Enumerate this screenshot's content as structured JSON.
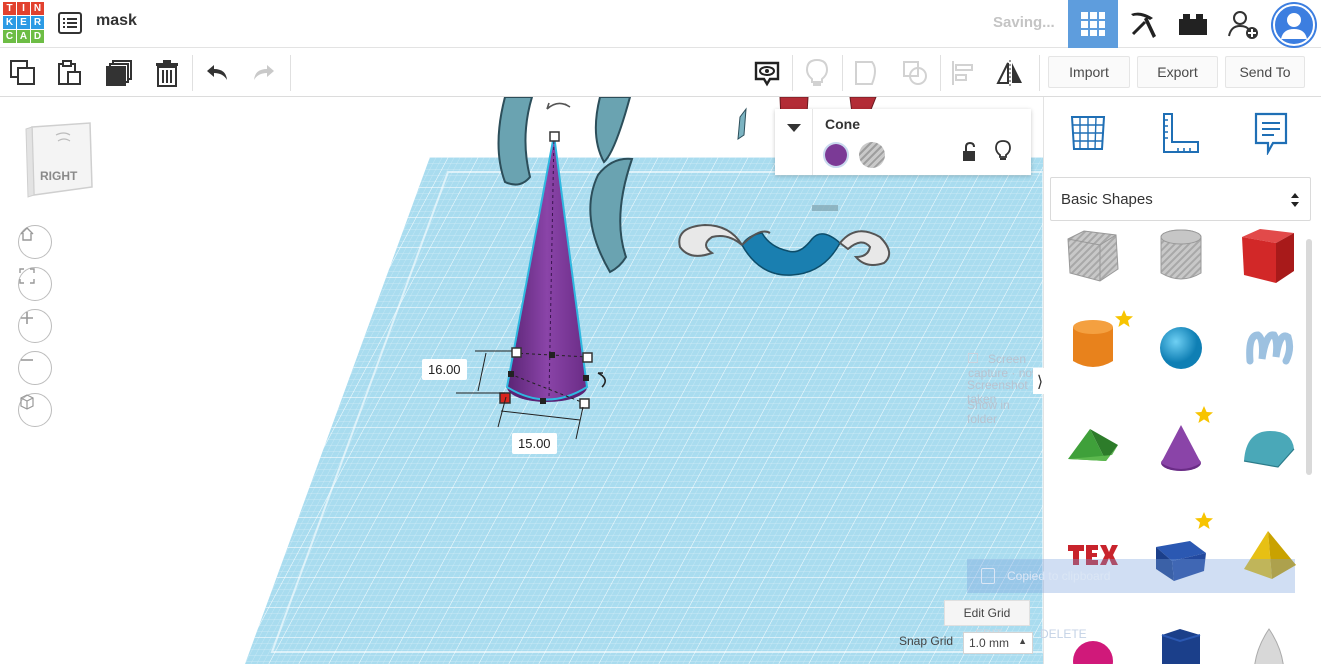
{
  "app": {
    "logo_letters": [
      "T",
      "I",
      "N",
      "K",
      "E",
      "R",
      "C",
      "A",
      "D"
    ],
    "logo_colors": [
      "#e2412e",
      "#e2412e",
      "#e2412e",
      "#2c9be5",
      "#2c9be5",
      "#2c9be5",
      "#6dbd45",
      "#6dbd45",
      "#6dbd45"
    ],
    "project_title": "mask",
    "status": "Saving..."
  },
  "header": {
    "icons": [
      "grid-view-icon",
      "pickaxe-icon",
      "bricks-icon",
      "add-user-icon",
      "user-avatar-icon"
    ]
  },
  "toolbar": {
    "left_icons": [
      "copy-icon",
      "paste-icon",
      "duplicate-icon",
      "trash-icon",
      "undo-icon",
      "redo-icon"
    ],
    "right_icons": [
      "notes-icon",
      "light-bulb-icon",
      "group-icon",
      "ungroup-icon",
      "align-icon",
      "mirror-icon"
    ],
    "import_label": "Import",
    "export_label": "Export",
    "send_to_label": "Send To"
  },
  "viewcube": {
    "face": "RIGHT"
  },
  "nav": [
    "home-icon",
    "fit-view-icon",
    "zoom-in-icon",
    "zoom-out-icon",
    "perspective-icon"
  ],
  "dimensions": {
    "height": "16.00",
    "width": "15.00"
  },
  "inspector": {
    "shape_name": "Cone",
    "solid_color": "#7b3a96",
    "hole_label": "hole"
  },
  "workplane": {
    "edit_grid_label": "Edit Grid",
    "snap_grid_label": "Snap Grid",
    "snap_value": "1.0 mm"
  },
  "overlay": {
    "notif_title": "Screen capture",
    "notif_time": "now",
    "notif_line1": "Screenshot taken",
    "notif_line2": "Show in folder",
    "clipboard": "Copied to clipboard",
    "edit_label": "EDIT",
    "delete_label": "DELETE"
  },
  "panel": {
    "tabs": [
      "workplane-icon",
      "ruler-icon",
      "notes-icon"
    ],
    "category": "Basic Shapes",
    "shapes": [
      "box-hole",
      "cylinder-hole",
      "box",
      "cylinder",
      "sphere",
      "scribble",
      "roof",
      "cone",
      "round-roof",
      "text",
      "wedge",
      "pyramid",
      "half-sphere",
      "polygon",
      "paraboloid"
    ]
  }
}
